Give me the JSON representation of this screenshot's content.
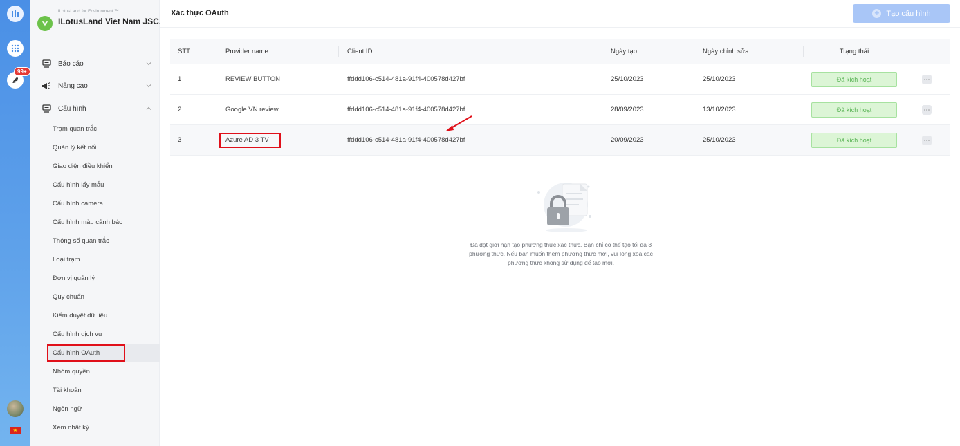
{
  "org": {
    "subtitle": "iLotusLand for Environment ™",
    "name": "ILotusLand Viet Nam JSC."
  },
  "rail": {
    "badge": "99+"
  },
  "sidebar": {
    "groups": [
      {
        "label": "Báo cáo",
        "icon": "monitor-icon"
      },
      {
        "label": "Nâng cao",
        "icon": "megaphone-icon"
      },
      {
        "label": "Cấu hình",
        "icon": "monitor-icon"
      }
    ],
    "items": [
      "Trạm quan trắc",
      "Quản lý kết nối",
      "Giao diện điều khiển",
      "Cấu hình lấy mẫu",
      "Cấu hình camera",
      "Cấu hình màu cảnh báo",
      "Thông số quan trắc",
      "Loại trạm",
      "Đơn vị quản lý",
      "Quy chuẩn",
      "Kiểm duyệt dữ liệu",
      "Cấu hình dịch vụ",
      "Cấu hình OAuth",
      "Nhóm quyền",
      "Tài khoản",
      "Ngôn ngữ",
      "Xem nhật ký"
    ],
    "active_item": "Cấu hình OAuth"
  },
  "header": {
    "title": "Xác thực OAuth",
    "create_label": "Tạo cấu hình"
  },
  "table": {
    "columns": [
      "STT",
      "Provider name",
      "Client ID",
      "Ngày tạo",
      "Ngày chỉnh sửa",
      "Trạng thái"
    ],
    "rows": [
      {
        "stt": "1",
        "provider": "REVIEW BUTTON",
        "client_id": "ffddd106-c514-481a-91f4-400578d427bf",
        "created": "25/10/2023",
        "modified": "25/10/2023",
        "status": "Đã kích hoạt"
      },
      {
        "stt": "2",
        "provider": "Google VN review",
        "client_id": "ffddd106-c514-481a-91f4-400578d427bf",
        "created": "28/09/2023",
        "modified": "13/10/2023",
        "status": "Đã kích hoạt"
      },
      {
        "stt": "3",
        "provider": "Azure AD 3 TV",
        "client_id": "ffddd106-c514-481a-91f4-400578d427bf",
        "created": "20/09/2023",
        "modified": "25/10/2023",
        "status": "Đã kích hoạt"
      }
    ]
  },
  "empty_message": "Đã đạt giới hạn tạo phương thức xác thực. Bạn chỉ có thể tạo tối đa 3 phương thức. Nếu bạn muốn thêm phương thức mới, vui lòng xóa các phương thức không sử dụng để tạo mới.",
  "colors": {
    "accent": "#a9c6f7",
    "highlight": "#e0101a",
    "status_bg": "#dcf5d6",
    "status_text": "#58b354",
    "rail": "#4a8fe6"
  }
}
